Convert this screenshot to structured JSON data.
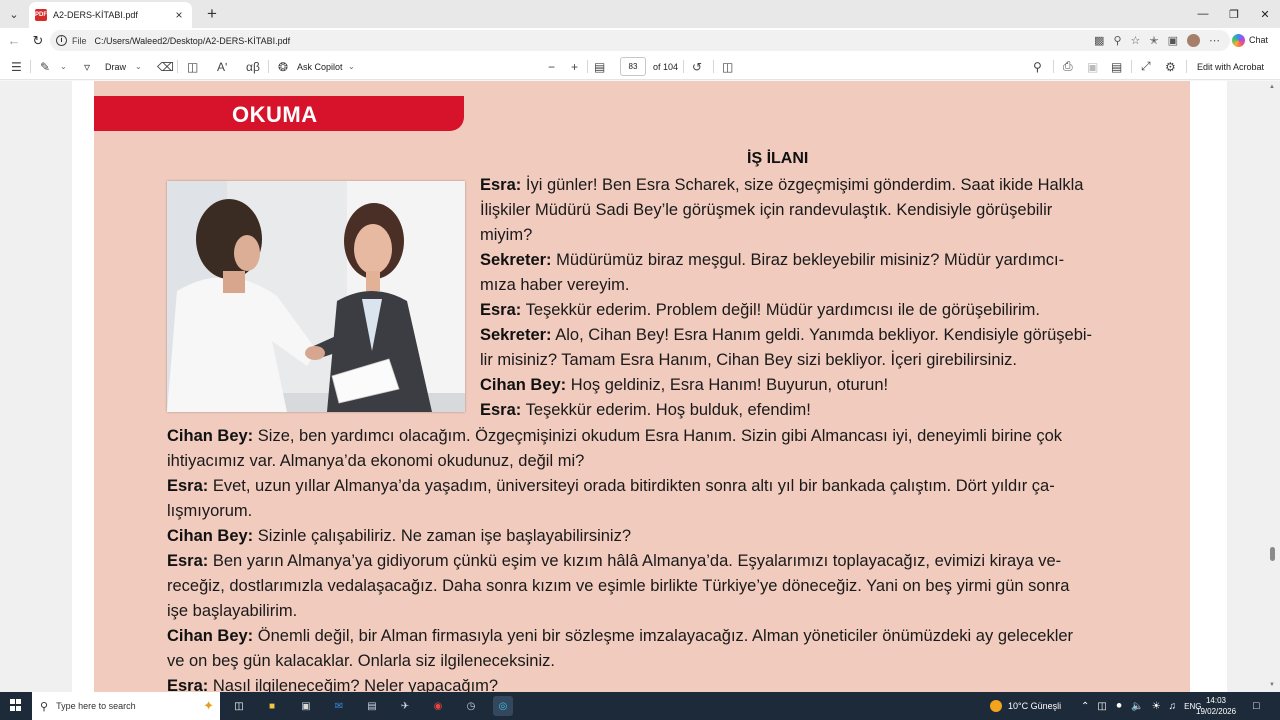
{
  "tab": {
    "title": "A2-DERS-KİTABI.pdf"
  },
  "address": {
    "label": "File",
    "url": "C:/Users/Waleed2/Desktop/A2-DERS-KİTABI.pdf",
    "chat": "Chat"
  },
  "toolbar": {
    "draw": "Draw",
    "ask_copilot": "Ask Copilot",
    "page_current": "83",
    "page_total": "of 104",
    "edit_acrobat": "Edit with Acrobat"
  },
  "document": {
    "section": "OKUMA",
    "title": "İŞ İLANI",
    "lines": [
      {
        "s": "Esra:",
        "t": " İyi günler! Ben Esra Scharek, size özgeçmişimi gönderdim. Saat ikide Halkla"
      },
      {
        "s": "",
        "t": "İlişkiler Müdürü Sadi Bey’le görüşmek için randevulaştık. Kendisiyle görüşebilir"
      },
      {
        "s": "",
        "t": "miyim?"
      },
      {
        "s": "Sekreter:",
        "t": "  Müdürümüz biraz meşgul. Biraz bekleyebilir misiniz? Müdür yardımcı-"
      },
      {
        "s": "",
        "t": "mıza haber vereyim."
      },
      {
        "s": "Esra:",
        "t": " Teşekkür ederim. Problem değil! Müdür yardımcısı ile de görüşebilirim."
      },
      {
        "s": "Sekreter:",
        "t": " Alo, Cihan Bey! Esra Hanım geldi. Yanımda bekliyor. Kendisiyle görüşebi-"
      },
      {
        "s": "",
        "t": "lir misiniz? Tamam Esra Hanım, Cihan Bey sizi bekliyor. İçeri girebilirsiniz."
      },
      {
        "s": "Cihan Bey:",
        "t": " Hoş geldiniz, Esra Hanım! Buyurun, oturun!"
      },
      {
        "s": "Esra:",
        "t": " Teşekkür ederim. Hoş bulduk, efendim!"
      },
      {
        "s": "Cihan Bey:",
        "t": " Size, ben yardımcı olacağım. Özgeçmişinizi okudum Esra Hanım. Sizin gibi Almancası iyi, deneyimli birine çok"
      },
      {
        "s": "",
        "t": "ihtiyacımız var. Almanya’da ekonomi okudunuz, değil mi?"
      },
      {
        "s": "Esra:",
        "t": " Evet, uzun yıllar Almanya’da yaşadım, üniversiteyi orada bitirdikten sonra altı yıl bir bankada çalıştım. Dört yıldır ça-"
      },
      {
        "s": "",
        "t": "lışmıyorum."
      },
      {
        "s": "Cihan Bey:",
        "t": " Sizinle çalışabiliriz. Ne zaman işe başlayabilirsiniz?"
      },
      {
        "s": "Esra:",
        "t": " Ben yarın Almanya’ya gidiyorum çünkü eşim ve kızım hâlâ Almanya’da. Eşyalarımızı toplayacağız, evimizi kiraya ve-"
      },
      {
        "s": "",
        "t": "receğiz, dostlarımızla vedalaşacağız. Daha sonra kızım ve eşimle birlikte Türkiye’ye döneceğiz. Yani on beş yirmi gün sonra"
      },
      {
        "s": "",
        "t": "işe başlayabilirim."
      },
      {
        "s": "Cihan Bey:",
        "t": " Önemli değil, bir Alman firmasıyla yeni bir sözleşme imzalayacağız. Alman yöneticiler önümüzdeki ay gelecekler"
      },
      {
        "s": "",
        "t": "ve on beş gün kalacaklar. Onlarla siz ilgileneceksiniz."
      },
      {
        "s": "Esra:",
        "t": " Nasıl ilgileneceğim? Neler yapacağım?"
      }
    ]
  },
  "taskbar": {
    "search_placeholder": "Type here to search",
    "weather": "10°C  Güneşli",
    "lang": "ENG",
    "time": "14:03",
    "date": "19/02/2026"
  }
}
